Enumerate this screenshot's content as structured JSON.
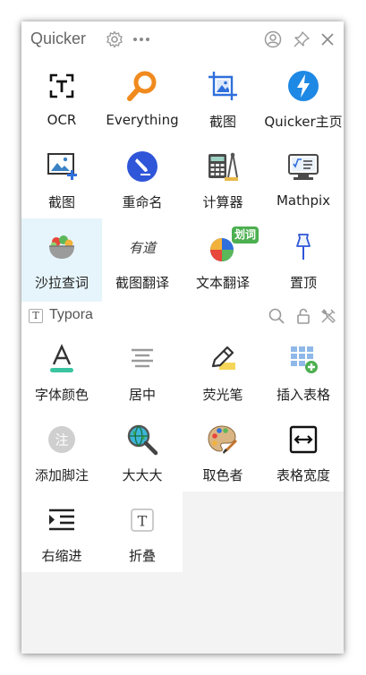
{
  "window": {
    "title": "Quicker",
    "icons": [
      "gear-icon",
      "more-icon",
      "user-icon",
      "pin-icon",
      "close-icon"
    ]
  },
  "colors": {
    "accent": "#2f6fdc",
    "selected_bg": "#e6f5fb",
    "background": "#f3f3f3"
  },
  "grid1": [
    {
      "label": "OCR",
      "icon": "ocr-scan-icon"
    },
    {
      "label": "Everything",
      "icon": "magnifier-icon"
    },
    {
      "label": "截图",
      "icon": "screenshot-icon"
    },
    {
      "label": "Quicker主页",
      "icon": "lightning-icon"
    },
    {
      "label": "截图",
      "icon": "screenshot-add-icon"
    },
    {
      "label": "重命名",
      "icon": "rename-pen-icon"
    },
    {
      "label": "计算器",
      "icon": "calculator-icon"
    },
    {
      "label": "Mathpix",
      "icon": "mathpix-icon"
    },
    {
      "label": "沙拉查词",
      "icon": "salad-icon"
    },
    {
      "label": "截图翻译",
      "icon": "youdao-icon"
    },
    {
      "label": "文本翻译",
      "icon": "translate-icon",
      "badge": "划词"
    },
    {
      "label": "置顶",
      "icon": "pushpin-icon"
    }
  ],
  "section": {
    "badge": "T",
    "title": "Typora",
    "icons": [
      "search-icon",
      "lock-icon",
      "tools-icon"
    ]
  },
  "grid2": [
    {
      "label": "字体颜色",
      "icon": "font-color-icon"
    },
    {
      "label": "居中",
      "icon": "align-center-icon"
    },
    {
      "label": "荧光笔",
      "icon": "highlighter-icon"
    },
    {
      "label": "插入表格",
      "icon": "insert-table-icon"
    },
    {
      "label": "添加脚注",
      "icon": "footnote-icon",
      "glyph": "注"
    },
    {
      "label": "大大大",
      "icon": "globe-magnifier-icon"
    },
    {
      "label": "取色者",
      "icon": "palette-icon"
    },
    {
      "label": "表格宽度",
      "icon": "table-width-icon"
    },
    {
      "label": "右缩进",
      "icon": "indent-right-icon"
    },
    {
      "label": "折叠",
      "icon": "fold-icon",
      "glyph": "T"
    }
  ]
}
